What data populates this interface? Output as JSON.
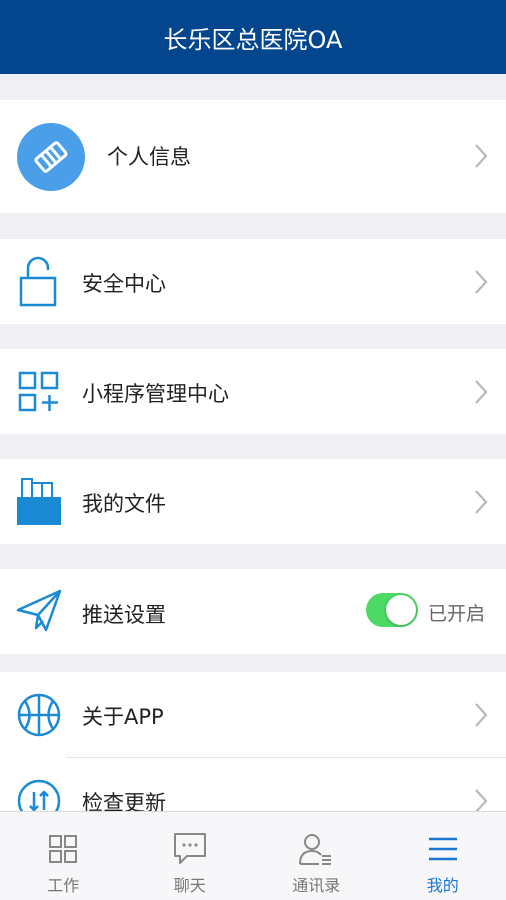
{
  "header": {
    "title": "长乐区总医院OA"
  },
  "menu": {
    "profile": {
      "label": "个人信息",
      "icon": "handshake-icon"
    },
    "security": {
      "label": "安全中心",
      "icon": "lock-icon"
    },
    "miniprogram": {
      "label": "小程序管理中心",
      "icon": "grid-plus-icon"
    },
    "files": {
      "label": "我的文件",
      "icon": "folder-icon"
    },
    "push": {
      "label": "推送设置",
      "icon": "paper-plane-icon",
      "toggle_on": true,
      "status": "已开启"
    },
    "about": {
      "label": "关于APP",
      "icon": "basketball-icon"
    },
    "update": {
      "label": "检查更新",
      "icon": "update-arrows-icon"
    }
  },
  "tabbar": {
    "tabs": [
      {
        "label": "工作",
        "icon": "grid-icon",
        "active": false
      },
      {
        "label": "聊天",
        "icon": "chat-bubble-icon",
        "active": false
      },
      {
        "label": "通讯录",
        "icon": "contacts-icon",
        "active": false
      },
      {
        "label": "我的",
        "icon": "menu-lines-icon",
        "active": true
      }
    ]
  },
  "colors": {
    "header_bg": "#03468e",
    "accent": "#1b76d1",
    "toggle_on": "#4cd964",
    "background": "#efeff4"
  }
}
